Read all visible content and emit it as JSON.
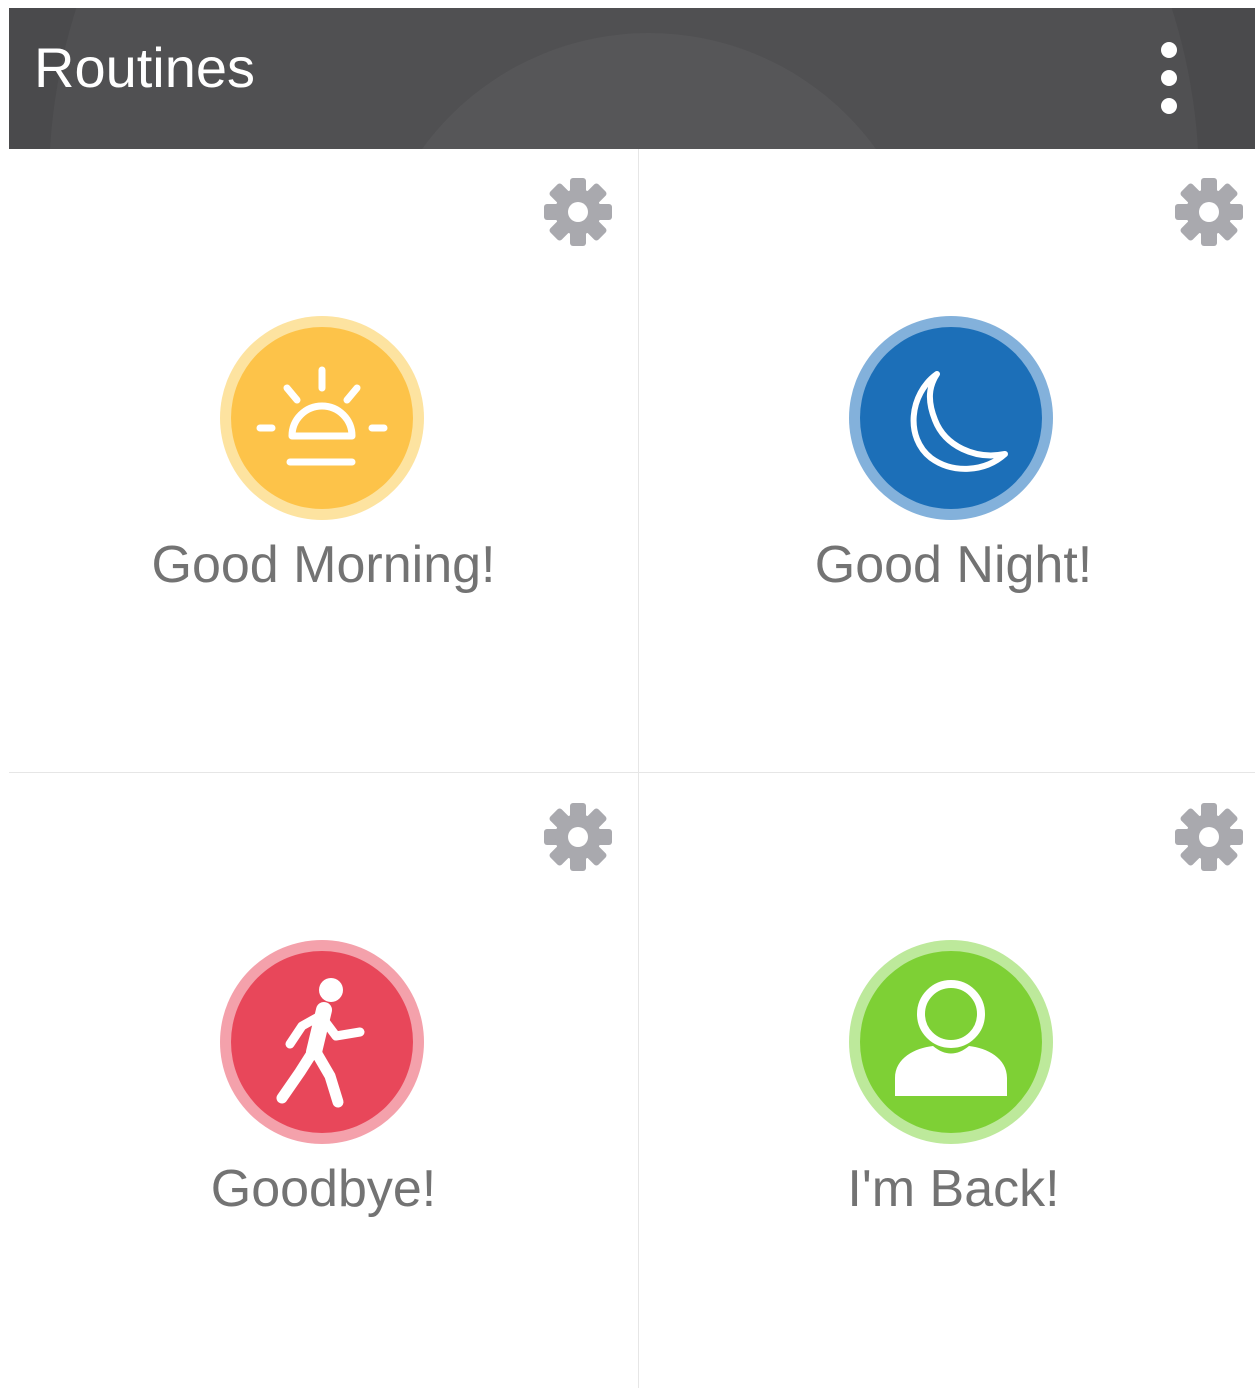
{
  "header": {
    "title": "Routines",
    "background_color": "#4a4a4c",
    "menu_icon": "more-vertical-icon"
  },
  "routines": [
    {
      "label": "Good Morning!",
      "icon": "sunrise-icon",
      "color": "#fdc349",
      "ring_color": "#fde3a0",
      "settings_icon": "gear-icon"
    },
    {
      "label": "Good Night!",
      "icon": "moon-icon",
      "color": "#1c6fb8",
      "ring_color": "#83b1db",
      "settings_icon": "gear-icon"
    },
    {
      "label": "Goodbye!",
      "icon": "walking-person-icon",
      "color": "#e8475a",
      "ring_color": "#f4a1ab",
      "settings_icon": "gear-icon"
    },
    {
      "label": "I'm Back!",
      "icon": "user-icon",
      "color": "#7ed035",
      "ring_color": "#bde99b",
      "settings_icon": "gear-icon"
    }
  ],
  "colors": {
    "label_text": "#737373",
    "gear": "#a9a9ae",
    "divider": "#e6e6e6"
  }
}
